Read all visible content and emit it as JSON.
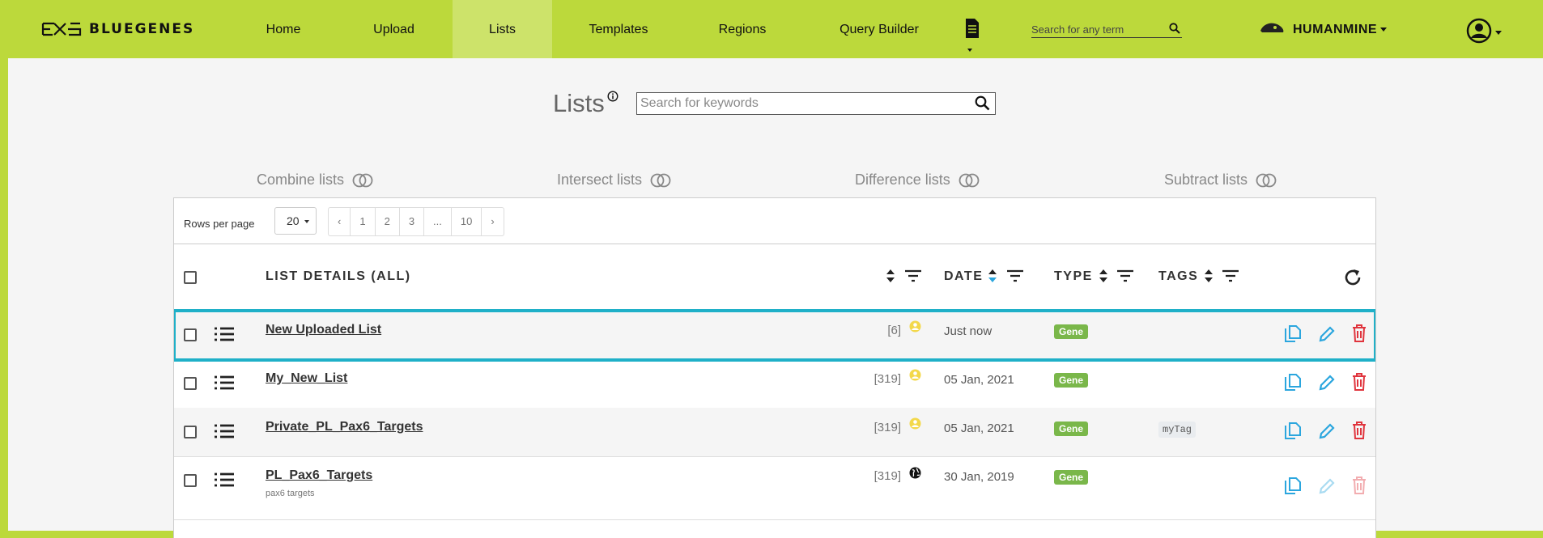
{
  "nav": {
    "brand": "BLUEGENES",
    "items": [
      "Home",
      "Upload",
      "Lists",
      "Templates",
      "Regions",
      "Query Builder"
    ],
    "active": "Lists",
    "search_placeholder": "Search for any term",
    "mine": "HUMANMINE"
  },
  "page": {
    "title": "Lists",
    "search_placeholder": "Search for keywords"
  },
  "operations": [
    "Combine lists",
    "Intersect lists",
    "Difference lists",
    "Subtract lists"
  ],
  "pager": {
    "rows_label": "Rows per page",
    "rows_value": "20",
    "pages": [
      "‹",
      "1",
      "2",
      "3",
      "...",
      "10",
      "›"
    ]
  },
  "headers": {
    "details": "LIST DETAILS (ALL)",
    "date": "DATE",
    "type": "TYPE",
    "tags": "TAGS"
  },
  "rows": [
    {
      "name": "New Uploaded List",
      "count": "[6]",
      "owner": "private",
      "date": "Just now",
      "type": "Gene",
      "tag": "",
      "desc": ""
    },
    {
      "name": "My_New_List",
      "count": "[319]",
      "owner": "private",
      "date": "05 Jan, 2021",
      "type": "Gene",
      "tag": "",
      "desc": ""
    },
    {
      "name": "Private_PL_Pax6_Targets",
      "count": "[319]",
      "owner": "private",
      "date": "05 Jan, 2021",
      "type": "Gene",
      "tag": "myTag",
      "desc": ""
    },
    {
      "name": "PL_Pax6_Targets",
      "count": "[319]",
      "owner": "public",
      "date": "30 Jan, 2019",
      "type": "Gene",
      "tag": "",
      "desc": "pax6 targets"
    }
  ],
  "colors": {
    "navbar": "#bcd93b",
    "active_tab": "#cde36a",
    "highlight": "#1fb0c8",
    "badge": "#7ab74a",
    "copy_icon": "#2ba6de",
    "delete_icon": "#e0343d"
  }
}
